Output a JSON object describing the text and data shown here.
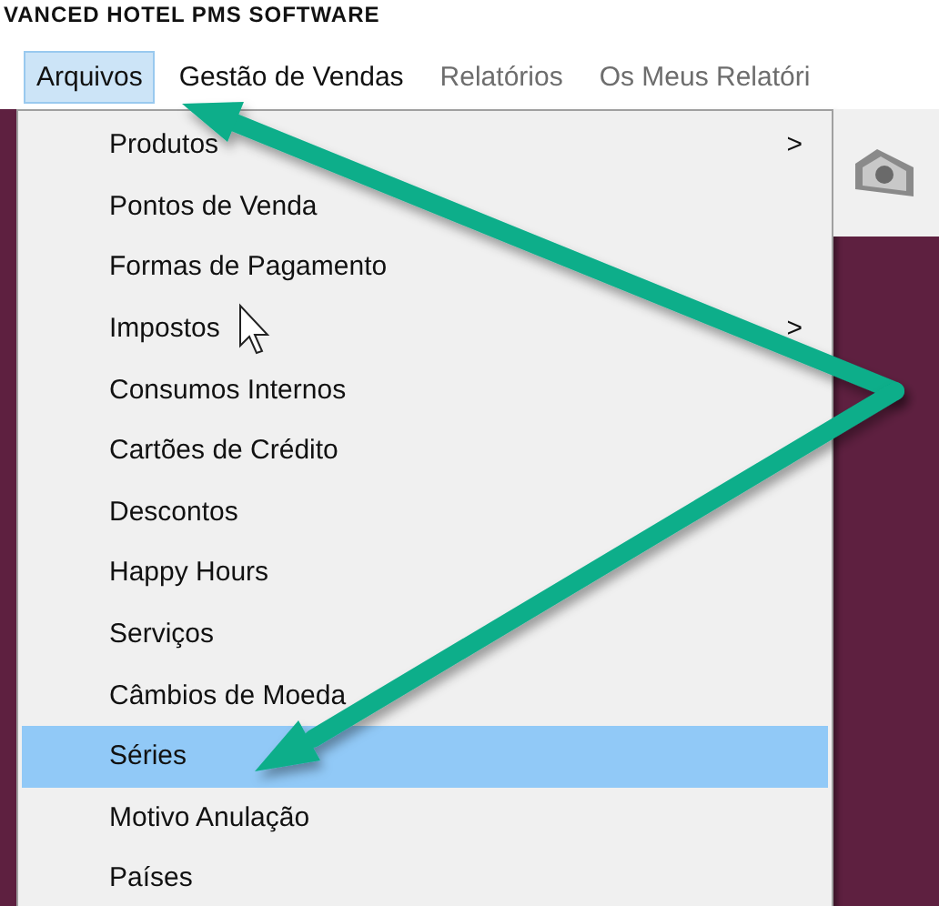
{
  "window": {
    "title": "VANCED HOTEL PMS SOFTWARE"
  },
  "menu_bar": [
    {
      "label": "Arquivos",
      "selected": true,
      "disabled": false
    },
    {
      "label": "Gestão de Vendas",
      "selected": false,
      "disabled": false
    },
    {
      "label": "Relatórios",
      "selected": false,
      "disabled": true
    },
    {
      "label": "Os Meus Relatóri",
      "selected": false,
      "disabled": true
    }
  ],
  "dropdown": [
    {
      "label": "Produtos",
      "selected": false,
      "submenu_arrow": ">"
    },
    {
      "label": "Pontos de Venda",
      "selected": false
    },
    {
      "label": "Formas de Pagamento",
      "selected": false
    },
    {
      "label": "Impostos",
      "selected": false,
      "submenu_arrow": ">"
    },
    {
      "label": "Consumos Internos",
      "selected": false
    },
    {
      "label": "Cartões de Crédito",
      "selected": false
    },
    {
      "label": "Descontos",
      "selected": false
    },
    {
      "label": "Happy Hours",
      "selected": false
    },
    {
      "label": "Serviços",
      "selected": false
    },
    {
      "label": "Câmbios de Moeda",
      "selected": false
    },
    {
      "label": "Séries",
      "selected": true
    },
    {
      "label": "Motivo Anulação",
      "selected": false
    },
    {
      "label": "Países",
      "selected": false
    }
  ]
}
